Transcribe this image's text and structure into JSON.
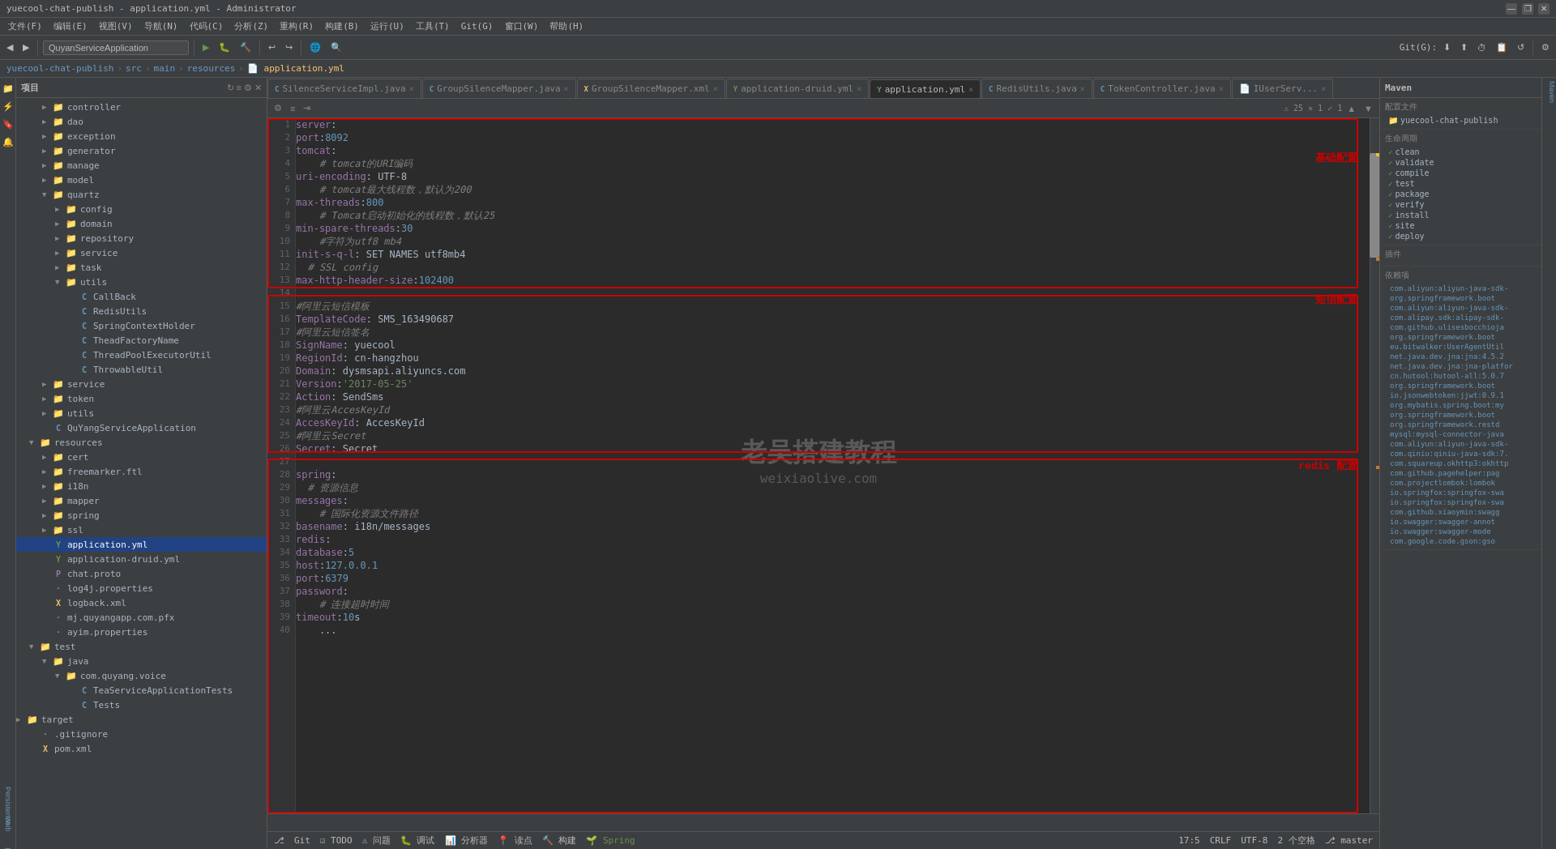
{
  "titleBar": {
    "title": "yuecool-chat-publish - application.yml - Administrator",
    "buttons": [
      "—",
      "❐",
      "✕"
    ]
  },
  "menuBar": {
    "items": [
      "文件(F)",
      "编辑(E)",
      "视图(V)",
      "导航(N)",
      "代码(C)",
      "分析(Z)",
      "重构(R)",
      "构建(B)",
      "运行(U)",
      "工具(T)",
      "Git(G)",
      "窗口(W)",
      "帮助(H)"
    ]
  },
  "toolbar": {
    "projectName": "QuyanServiceApplication",
    "gitBranch": "Git(G):"
  },
  "breadcrumb": {
    "parts": [
      "yuecool-chat-publish",
      "src",
      "main",
      "resources",
      "application.yml"
    ]
  },
  "tabs": [
    {
      "label": "SilenceServiceImpl.java",
      "active": false
    },
    {
      "label": "GroupSilenceMapper.java",
      "active": false
    },
    {
      "label": "GroupSilenceMapper.xml",
      "active": false
    },
    {
      "label": "application-druid.yml",
      "active": false
    },
    {
      "label": "application.yml",
      "active": true
    },
    {
      "label": "RedisUtils.java",
      "active": false
    },
    {
      "label": "TokenController.java",
      "active": false
    },
    {
      "label": "IUserServ...",
      "active": false
    }
  ],
  "sidebar": {
    "title": "项目",
    "tree": [
      {
        "indent": 2,
        "type": "folder",
        "label": "controller",
        "expanded": false
      },
      {
        "indent": 2,
        "type": "folder",
        "label": "dao",
        "expanded": false
      },
      {
        "indent": 2,
        "type": "folder",
        "label": "exception",
        "expanded": false
      },
      {
        "indent": 2,
        "type": "folder",
        "label": "generator",
        "expanded": false
      },
      {
        "indent": 2,
        "type": "folder",
        "label": "manage",
        "expanded": false
      },
      {
        "indent": 2,
        "type": "folder",
        "label": "model",
        "expanded": false
      },
      {
        "indent": 2,
        "type": "folder",
        "label": "quartz",
        "expanded": true
      },
      {
        "indent": 3,
        "type": "folder",
        "label": "config",
        "expanded": false
      },
      {
        "indent": 3,
        "type": "folder",
        "label": "domain",
        "expanded": false
      },
      {
        "indent": 3,
        "type": "folder",
        "label": "repository",
        "expanded": false
      },
      {
        "indent": 3,
        "type": "folder",
        "label": "service",
        "expanded": false
      },
      {
        "indent": 3,
        "type": "folder",
        "label": "task",
        "expanded": false
      },
      {
        "indent": 3,
        "type": "folder",
        "label": "utils",
        "expanded": true
      },
      {
        "indent": 4,
        "type": "java",
        "label": "CallBack",
        "expanded": false
      },
      {
        "indent": 4,
        "type": "java",
        "label": "RedisUtils",
        "expanded": false
      },
      {
        "indent": 4,
        "type": "java",
        "label": "SpringContextHolder",
        "expanded": false
      },
      {
        "indent": 4,
        "type": "java",
        "label": "TheadFactoryName",
        "expanded": false
      },
      {
        "indent": 4,
        "type": "java",
        "label": "ThreadPoolExecutorUtil",
        "expanded": false
      },
      {
        "indent": 4,
        "type": "java",
        "label": "ThrowableUtil",
        "expanded": false
      },
      {
        "indent": 2,
        "type": "folder",
        "label": "service",
        "expanded": false
      },
      {
        "indent": 2,
        "type": "folder",
        "label": "token",
        "expanded": false
      },
      {
        "indent": 2,
        "type": "folder",
        "label": "utils",
        "expanded": false
      },
      {
        "indent": 2,
        "type": "java",
        "label": "QuYangServiceApplication",
        "expanded": false
      },
      {
        "indent": 1,
        "type": "folder",
        "label": "resources",
        "expanded": true
      },
      {
        "indent": 2,
        "type": "folder",
        "label": "cert",
        "expanded": false
      },
      {
        "indent": 2,
        "type": "folder",
        "label": "freemarker.ftl",
        "expanded": false
      },
      {
        "indent": 2,
        "type": "folder",
        "label": "i18n",
        "expanded": false
      },
      {
        "indent": 2,
        "type": "folder",
        "label": "mapper",
        "expanded": false
      },
      {
        "indent": 2,
        "type": "folder",
        "label": "spring",
        "expanded": false
      },
      {
        "indent": 2,
        "type": "folder",
        "label": "ssl",
        "expanded": false
      },
      {
        "indent": 2,
        "type": "yaml",
        "label": "application.yml",
        "expanded": false,
        "selected": true
      },
      {
        "indent": 2,
        "type": "yaml",
        "label": "application-druid.yml",
        "expanded": false
      },
      {
        "indent": 2,
        "type": "proto",
        "label": "chat.proto",
        "expanded": false
      },
      {
        "indent": 2,
        "type": "prop",
        "label": "log4j.properties",
        "expanded": false
      },
      {
        "indent": 2,
        "type": "xml",
        "label": "logback.xml",
        "expanded": false
      },
      {
        "indent": 2,
        "type": "prop",
        "label": "mj.quyangapp.com.pfx",
        "expanded": false
      },
      {
        "indent": 2,
        "type": "prop",
        "label": "ayim.properties",
        "expanded": false
      },
      {
        "indent": 1,
        "type": "folder",
        "label": "test",
        "expanded": true
      },
      {
        "indent": 2,
        "type": "folder",
        "label": "java",
        "expanded": true
      },
      {
        "indent": 3,
        "type": "folder",
        "label": "com.quyang.voice",
        "expanded": true
      },
      {
        "indent": 4,
        "type": "java",
        "label": "TeaServiceApplicationTests",
        "expanded": false
      },
      {
        "indent": 4,
        "type": "java",
        "label": "Tests",
        "expanded": false
      },
      {
        "indent": 0,
        "type": "folder",
        "label": "target",
        "expanded": false
      },
      {
        "indent": 1,
        "type": "prop",
        "label": ".gitignore",
        "expanded": false
      },
      {
        "indent": 1,
        "type": "xml",
        "label": "pom.xml",
        "expanded": false
      }
    ]
  },
  "editor": {
    "filename": "application.yml",
    "lines": [
      {
        "num": 1,
        "content": "server:"
      },
      {
        "num": 2,
        "content": "  port: 8092"
      },
      {
        "num": 3,
        "content": "  tomcat:"
      },
      {
        "num": 4,
        "content": "    # tomcat的URI编码"
      },
      {
        "num": 5,
        "content": "    uri-encoding: UTF-8"
      },
      {
        "num": 6,
        "content": "    # tomcat最大线程数，默认为200"
      },
      {
        "num": 7,
        "content": "    max-threads: 800"
      },
      {
        "num": 8,
        "content": "    # Tomcat启动初始化的线程数，默认25"
      },
      {
        "num": 9,
        "content": "    min-spare-threads: 30"
      },
      {
        "num": 10,
        "content": "    #字符为utf8 mb4"
      },
      {
        "num": 11,
        "content": "    init-s-q-l: SET NAMES utf8mb4"
      },
      {
        "num": 12,
        "content": "  # SSL config"
      },
      {
        "num": 13,
        "content": "  max-http-header-size: 102400"
      },
      {
        "num": 14,
        "content": ""
      },
      {
        "num": 15,
        "content": "#阿里云短信模板"
      },
      {
        "num": 16,
        "content": "TemplateCode: SMS_163490687"
      },
      {
        "num": 17,
        "content": "#阿里云短信签名"
      },
      {
        "num": 18,
        "content": "SignName: yuecool"
      },
      {
        "num": 19,
        "content": "RegionId: cn-hangzhou"
      },
      {
        "num": 20,
        "content": "Domain: dysmsapi.aliyuncs.com"
      },
      {
        "num": 21,
        "content": "Version: '2017-05-25'"
      },
      {
        "num": 22,
        "content": "Action: SendSms"
      },
      {
        "num": 23,
        "content": "#阿里云AccesKeyId"
      },
      {
        "num": 24,
        "content": "AccesKeyId: AccesKeyId"
      },
      {
        "num": 25,
        "content": "#阿里云Secret"
      },
      {
        "num": 26,
        "content": "Secret: Secret"
      },
      {
        "num": 27,
        "content": ""
      },
      {
        "num": 28,
        "content": "spring:"
      },
      {
        "num": 29,
        "content": "  # 资源信息"
      },
      {
        "num": 30,
        "content": "  messages:"
      },
      {
        "num": 31,
        "content": "    # 国际化资源文件路径"
      },
      {
        "num": 32,
        "content": "    basename: i18n/messages"
      },
      {
        "num": 33,
        "content": "  redis:"
      },
      {
        "num": 34,
        "content": "    database: 5"
      },
      {
        "num": 35,
        "content": "    host: 127.0.0.1"
      },
      {
        "num": 36,
        "content": "    port: 6379"
      },
      {
        "num": 37,
        "content": "    password:"
      },
      {
        "num": 38,
        "content": "    # 连接超时时间"
      },
      {
        "num": 39,
        "content": "    timeout: 10s"
      },
      {
        "num": 40,
        "content": "    ..."
      }
    ],
    "sections": [
      {
        "label": "基础配置",
        "color": "#cc0000"
      },
      {
        "label": "短信配置",
        "color": "#cc0000"
      },
      {
        "label": "redis 配置",
        "color": "#cc0000"
      }
    ]
  },
  "rightPanel": {
    "title": "Maven",
    "configTitle": "配置文件",
    "projectName": "yuecool-chat-publish",
    "lifecycleTitle": "生命周期",
    "lifecycle": [
      "clean",
      "validate",
      "compile",
      "test",
      "package",
      "verify",
      "install",
      "site",
      "deploy"
    ],
    "pluginsTitle": "插件",
    "depsTitle": "依赖项",
    "dependencies": [
      "com.aliyun:aliyun-java-sdk-",
      "org.springframework.boot",
      "com.aliyun:aliyun-java-sdk-",
      "com.alipay.sdk:alipay-sdk-",
      "com.github.ulisesbocchioja",
      "org.springframework.boot",
      "eu.bitwalker:UserAgentUtil",
      "net.java.dev.jna:jna:4.5.2",
      "net.java.dev.jna:jna-platfor",
      "cn.hutool:hutool-all:5.0.7",
      "org.springframework.boot",
      "io.jsonwebtoken:jjwt:0.9.1",
      "org.mybatis.spring.boot:my",
      "org.springframework.boot",
      "org.springframework.restd",
      "mysql:mysql-connector-java",
      "com.aliyun:aliyun-java-sdk-",
      "com.qiniu:qiniu-java-sdk:7.",
      "com.squareup.okhttp3:okhttp",
      "com.github.pagehelper:pag",
      "com.projectlombok:lombok",
      "io.springfox:springfox-swa",
      "io.springfox:springfox-swa",
      "com.github.xiaoymin:swagg",
      "io.swagger:swagger-annot",
      "io.swagger:swagger-mode",
      "com.google.code.gson:gso"
    ]
  },
  "statusBar": {
    "warnings": "⚠ 25",
    "errors1": "✕ 1",
    "info": "✓ 1",
    "position": "17:5",
    "lineEnding": "CRLF",
    "encoding": "UTF-8",
    "indent": "2 个空格",
    "branch": "master",
    "bottom_tabs": [
      "Git",
      "TODO",
      "问题",
      "调试",
      "分析器",
      "读点",
      "构建",
      "Spring"
    ]
  },
  "watermark": {
    "line1": "老吴搭建教程",
    "line2": "weixiaolive.com"
  }
}
